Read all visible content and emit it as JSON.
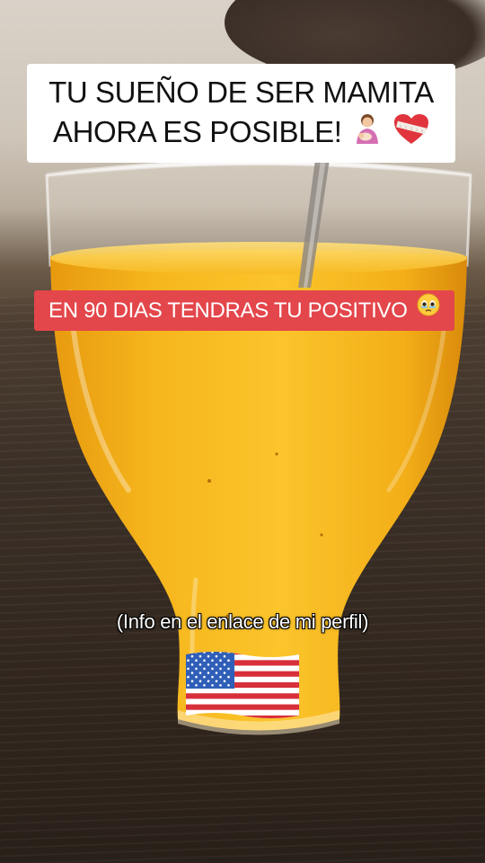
{
  "overlay": {
    "headline_line1": "TU SUEÑO DE SER MAMITA",
    "headline_line2": "AHORA ES POSIBLE!",
    "headline_emoji_1": "breastfeeding-mother-emoji",
    "headline_emoji_2": "mended-heart-emoji",
    "subtitle": "EN 90 DIAS TENDRAS TU POSITIVO",
    "subtitle_emoji": "face-holding-back-tears-emoji",
    "info": "(Info en el enlace de mi perfil)",
    "flag": "united-states-flag-emoji"
  },
  "colors": {
    "headline_bg": "#ffffff",
    "headline_text": "#111111",
    "subtitle_bg": "#e3464b",
    "subtitle_text": "#ffffff",
    "drink": "#f5b21c"
  }
}
